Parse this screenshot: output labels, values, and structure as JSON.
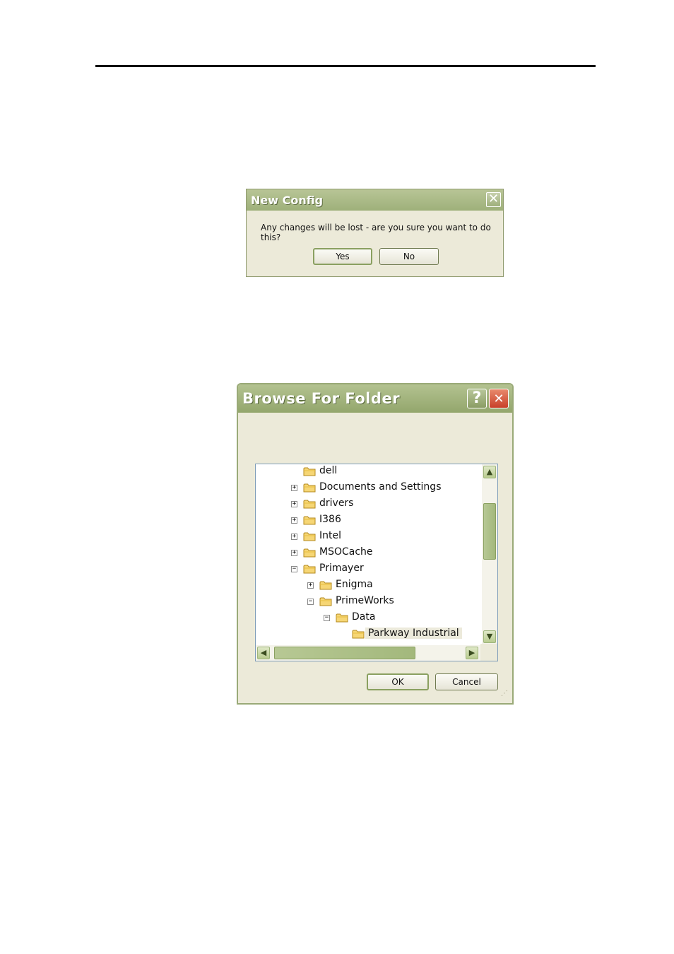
{
  "new_config": {
    "title": "New Config",
    "close_glyph": "✕",
    "message": "Any changes will be lost - are you sure you want to do this?",
    "yes_label": "Yes",
    "no_label": "No"
  },
  "browse": {
    "title": "Browse For Folder",
    "help_glyph": "?",
    "close_glyph": "✕",
    "tree": [
      {
        "label": "dell",
        "expander": ""
      },
      {
        "label": "Documents and Settings",
        "expander": "+"
      },
      {
        "label": "drivers",
        "expander": "+"
      },
      {
        "label": "I386",
        "expander": "+"
      },
      {
        "label": "Intel",
        "expander": "+"
      },
      {
        "label": "MSOCache",
        "expander": "+"
      },
      {
        "label": "Primayer",
        "expander": "−"
      },
      {
        "label": "Enigma",
        "expander": "+"
      },
      {
        "label": "PrimeWorks",
        "expander": "−"
      },
      {
        "label": "Data",
        "expander": "−"
      },
      {
        "label": "Parkway Industrial",
        "expander": "",
        "selected": true
      }
    ],
    "ok_label": "OK",
    "cancel_label": "Cancel",
    "scroll_up_glyph": "▲",
    "scroll_down_glyph": "▼",
    "scroll_left_glyph": "◀",
    "scroll_right_glyph": "▶"
  }
}
